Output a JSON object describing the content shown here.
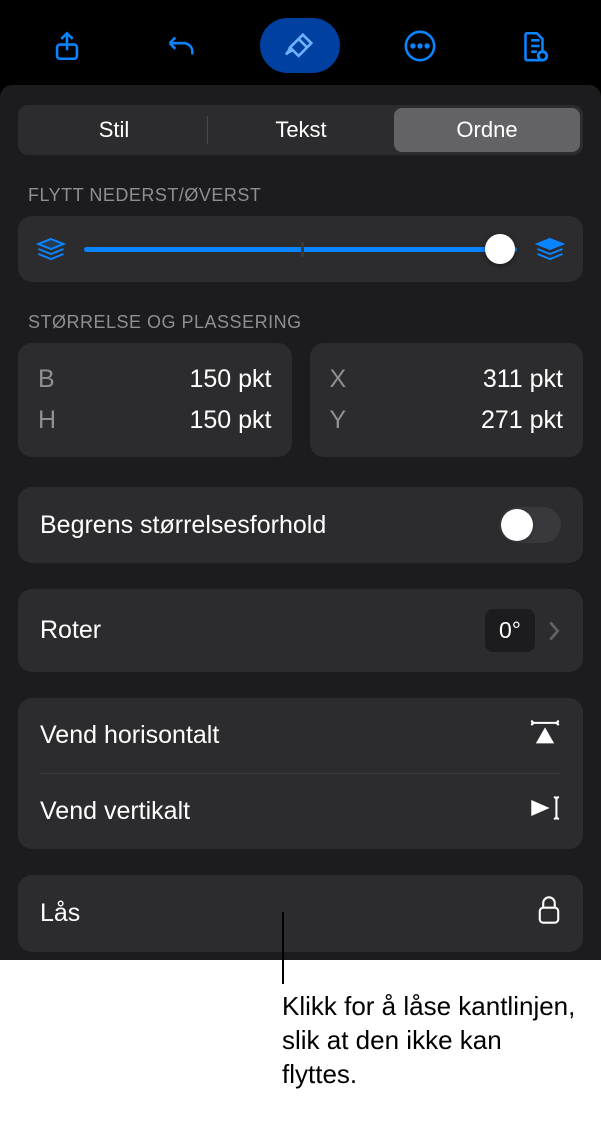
{
  "toolbar": {
    "share_icon": "share-icon",
    "undo_icon": "undo-icon",
    "format_icon": "format-brush-icon",
    "more_icon": "more-icon",
    "doc_icon": "document-icon"
  },
  "tabs": {
    "style": "Stil",
    "text": "Tekst",
    "arrange": "Ordne"
  },
  "layer": {
    "section_label": "FLYTT NEDERST/ØVERST"
  },
  "size": {
    "section_label": "STØRRELSE OG PLASSERING",
    "w_key": "B",
    "w_val": "150 pkt",
    "h_key": "H",
    "h_val": "150 pkt",
    "x_key": "X",
    "x_val": "311 pkt",
    "y_key": "Y",
    "y_val": "271 pkt"
  },
  "constrain": {
    "label": "Begrens størrelsesforhold"
  },
  "rotate": {
    "label": "Roter",
    "value": "0°"
  },
  "flip": {
    "h_label": "Vend horisontalt",
    "v_label": "Vend vertikalt"
  },
  "lock": {
    "label": "Lås"
  },
  "callout": {
    "text": "Klikk for å låse kantlinjen, slik at den ikke kan flyttes."
  }
}
